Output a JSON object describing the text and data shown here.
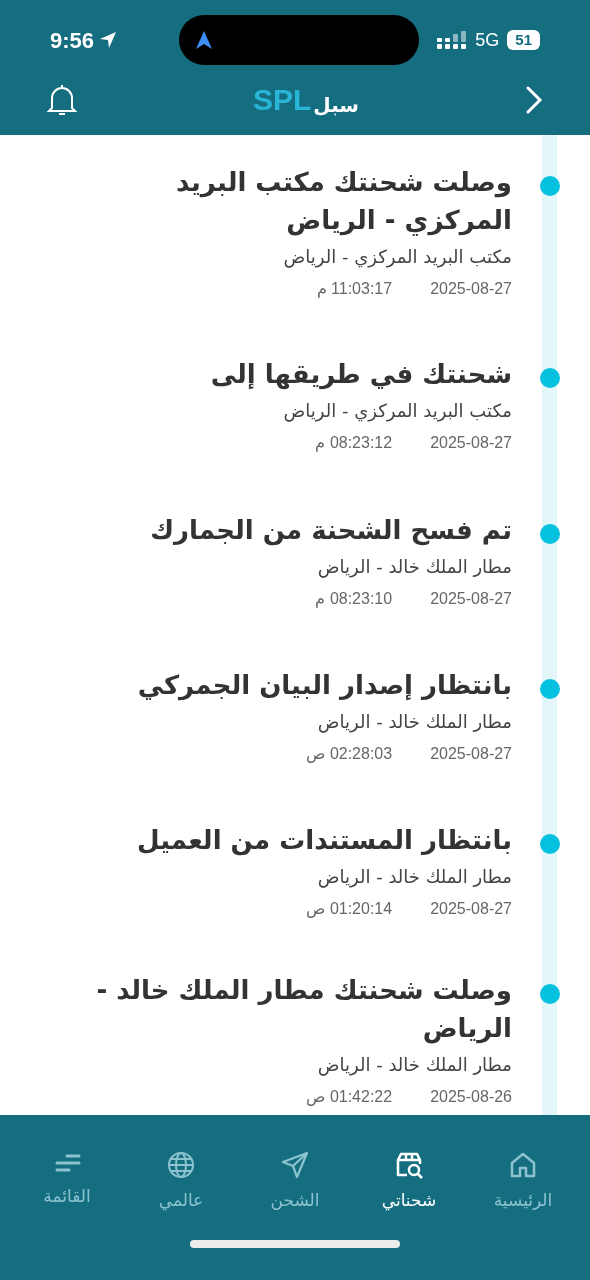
{
  "status_bar": {
    "time": "9:56",
    "network": "5G",
    "battery": "51"
  },
  "header": {
    "logo_latin": "SPL",
    "logo_arabic": "سبل"
  },
  "events": [
    {
      "title": "وصلت شحنتك مكتب البريد المركزي - الرياض",
      "location": "مكتب البريد المركزي - الرياض",
      "date": "2025-08-27",
      "time": "11:03:17 م"
    },
    {
      "title": "شحنتك في طريقها إلى",
      "location": "مكتب البريد المركزي - الرياض",
      "date": "2025-08-27",
      "time": "08:23:12 م"
    },
    {
      "title": "تم فسح الشحنة من الجمارك",
      "location": "مطار الملك خالد - الرياض",
      "date": "2025-08-27",
      "time": "08:23:10 م"
    },
    {
      "title": "بانتظار إصدار البيان الجمركي",
      "location": "مطار الملك خالد - الرياض",
      "date": "2025-08-27",
      "time": "02:28:03 ص"
    },
    {
      "title": "بانتظار المستندات من العميل",
      "location": "مطار الملك خالد - الرياض",
      "date": "2025-08-27",
      "time": "01:20:14 ص"
    },
    {
      "title": "وصلت شحنتك مطار الملك خالد - الرياض",
      "location": "مطار الملك خالد - الرياض",
      "date": "2025-08-26",
      "time": "01:42:22 ص"
    }
  ],
  "tab_bar": [
    {
      "kind": "home",
      "label": "الرئيسية",
      "selected": false
    },
    {
      "kind": "shipments",
      "label": "شحناتي",
      "selected": true
    },
    {
      "kind": "send",
      "label": "الشحن",
      "selected": false
    },
    {
      "kind": "globe",
      "label": "عالمي",
      "selected": false
    },
    {
      "kind": "menu",
      "label": "القائمة",
      "selected": false
    }
  ]
}
